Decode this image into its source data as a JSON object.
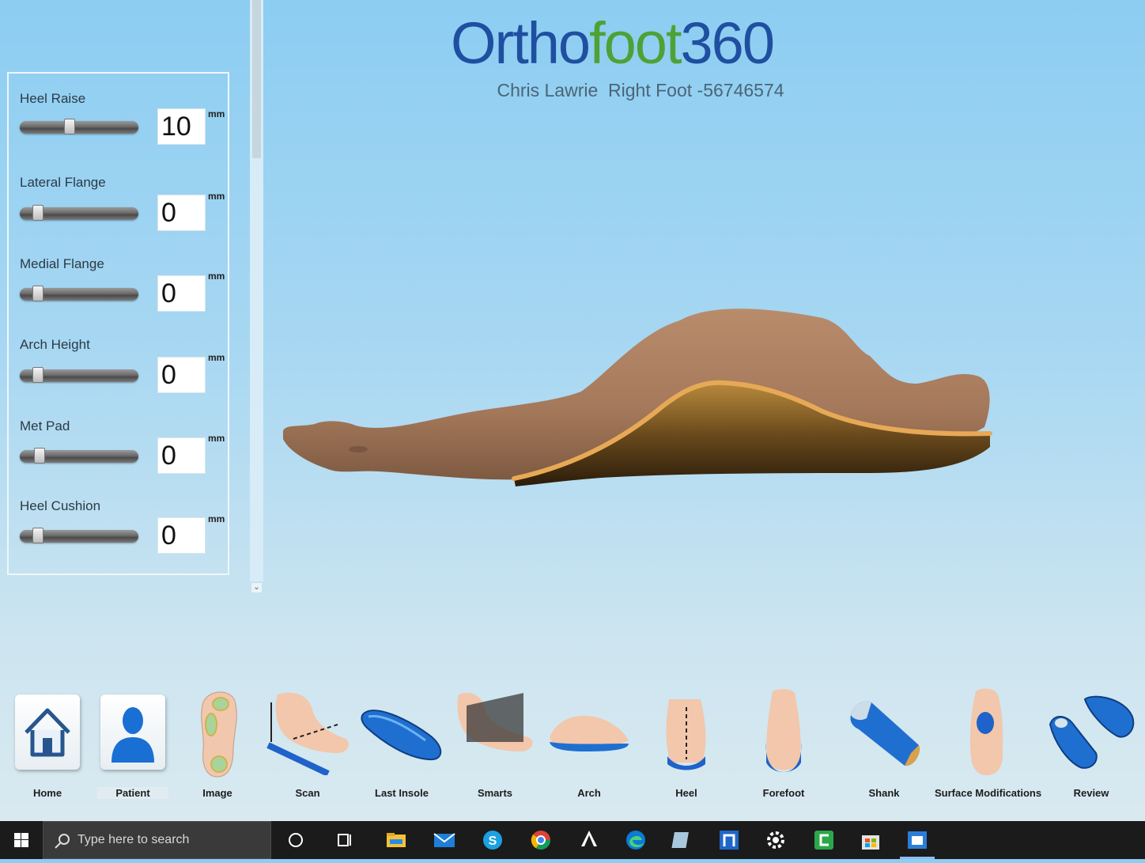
{
  "header": {
    "logo_part1": "Orthо",
    "logo_part1_text": "Ortho",
    "logo_part2": "foot",
    "logo_part3": "360",
    "subtitle": "Chris Lawrie  Right Foot -56746574"
  },
  "controls": [
    {
      "label": "Heel Raise",
      "value": "10",
      "unit": "mm",
      "level": 0.38
    },
    {
      "label": "Lateral Flange",
      "value": "0",
      "unit": "mm",
      "level": 0.0
    },
    {
      "label": "Medial Flange",
      "value": "0",
      "unit": "mm",
      "level": 0.0
    },
    {
      "label": "Arch Height",
      "value": "0",
      "unit": "mm",
      "level": 0.0
    },
    {
      "label": "Met Pad",
      "value": "0",
      "unit": "mm",
      "level": 0.02
    },
    {
      "label": "Heel Cushion",
      "value": "0",
      "unit": "mm",
      "level": 0.0
    }
  ],
  "toolbar": [
    {
      "label": "Home",
      "icon": "home-icon"
    },
    {
      "label": "Patient",
      "icon": "patient-icon"
    },
    {
      "label": "Image",
      "icon": "foot-image-icon"
    },
    {
      "label": "Scan",
      "icon": "scan-icon"
    },
    {
      "label": "Last Insole",
      "icon": "insole-icon"
    },
    {
      "label": "Smarts",
      "icon": "smarts-icon"
    },
    {
      "label": "Arch",
      "icon": "arch-icon"
    },
    {
      "label": "Heel",
      "icon": "heel-icon"
    },
    {
      "label": "Forefoot",
      "icon": "forefoot-icon"
    },
    {
      "label": "Shank",
      "icon": "shank-icon"
    },
    {
      "label": "Surface Modifications",
      "icon": "surface-modifications-icon"
    },
    {
      "label": "Review",
      "icon": "review-icon"
    }
  ],
  "taskbar": {
    "search_placeholder": "Type here to search"
  },
  "colors": {
    "logo_blue": "#1f4fa0",
    "logo_green": "#4ea235",
    "insole_blue": "#1f6fd0"
  }
}
